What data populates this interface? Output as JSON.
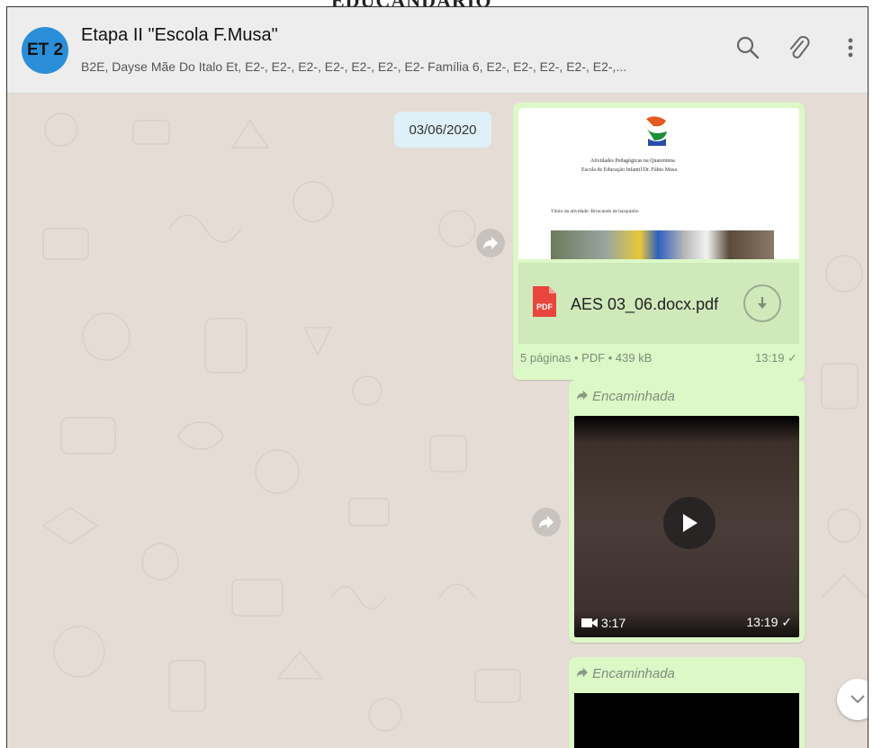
{
  "header": {
    "avatar_initials": "ET 2",
    "title": "Etapa II \"Escola F.Musa\"",
    "subtitle": "B2E, Dayse Mãe Do Italo Et, E2-, E2-, E2-, E2-, E2-, E2-, E2- Família 6, E2-, E2-, E2-, E2-, E2-,...",
    "icons": [
      "search-icon",
      "attach-icon",
      "menu-icon"
    ]
  },
  "chat": {
    "date_chip": "03/06/2020",
    "doc_message": {
      "preview_lines": [
        "Atividades Pedagógicas na Quarentena",
        "Escola de Educação Infantil Dr. Fábio Musa",
        "Título da atividade: Brincando de barquinho"
      ],
      "file_badge": "PDF",
      "file_name": "AES 03_06.docx.pdf",
      "meta": "5 páginas • PDF • 439 kB",
      "time": "13:19 ✓"
    },
    "video_message": {
      "forward_label": "Encaminhada",
      "duration": "3:17",
      "time": "13:19 ✓"
    },
    "video_message_2": {
      "forward_label": "Encaminhada"
    }
  },
  "colors": {
    "header_bg": "#ededed",
    "avatar_bg": "#2b8ed8",
    "bubble_out": "#dcf8c6",
    "chat_bg": "#e5ddd5",
    "date_chip": "#dff1f8"
  }
}
